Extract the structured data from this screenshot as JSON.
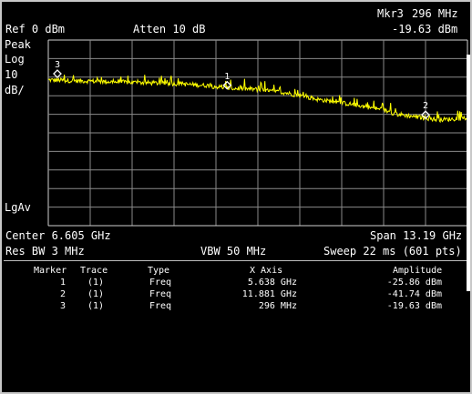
{
  "header": {
    "ref_level": "Ref 0 dBm",
    "attenuation": "Atten 10 dB",
    "marker_readout_label": "Mkr3",
    "marker_readout_freq": "296 MHz",
    "marker_readout_amp": "-19.63 dBm"
  },
  "side_labels": {
    "peak": "Peak",
    "log": "Log",
    "scale_value": "10",
    "scale_unit": "dB/",
    "detector": "LgAv"
  },
  "footer": {
    "center": "Center 6.605 GHz",
    "span": "Span 13.19 GHz",
    "res_bw": "Res BW 3 MHz",
    "vbw": "VBW 50 MHz",
    "sweep": "Sweep 22 ms (601 pts)"
  },
  "marker_table": {
    "columns": [
      "Marker",
      "Trace",
      "Type",
      "X Axis",
      "Amplitude"
    ],
    "rows": [
      {
        "marker": "1",
        "trace": "(1)",
        "type": "Freq",
        "x": "5.638 GHz",
        "amp": "-25.86 dBm"
      },
      {
        "marker": "2",
        "trace": "(1)",
        "type": "Freq",
        "x": "11.881 GHz",
        "amp": "-41.74 dBm"
      },
      {
        "marker": "3",
        "trace": "(1)",
        "type": "Freq",
        "x": "296 MHz",
        "amp": "-19.63 dBm"
      }
    ]
  },
  "chart_data": {
    "type": "line",
    "x_unit": "GHz",
    "y_unit": "dBm",
    "xlim": [
      0.01,
      13.2
    ],
    "ylim": [
      -100,
      0
    ],
    "grid": true,
    "trace_color": "#ffff00",
    "series": [
      {
        "x": [
          0.01,
          1.0,
          2.0,
          3.0,
          4.0,
          5.0,
          5.638,
          6.5,
          7.5,
          8.5,
          9.5,
          10.5,
          11.0,
          11.881,
          12.3,
          13.2
        ],
        "values": [
          -21.5,
          -22.0,
          -22.5,
          -23.0,
          -23.5,
          -24.5,
          -25.9,
          -26.5,
          -28.5,
          -32.0,
          -34.5,
          -37.5,
          -40.0,
          -42.0,
          -43.0,
          -42.0
        ]
      }
    ],
    "markers": [
      {
        "label": "1",
        "x": 5.638,
        "y": -25.86
      },
      {
        "label": "2",
        "x": 11.881,
        "y": -41.74
      },
      {
        "label": "3",
        "x": 0.296,
        "y": -19.63
      }
    ]
  }
}
